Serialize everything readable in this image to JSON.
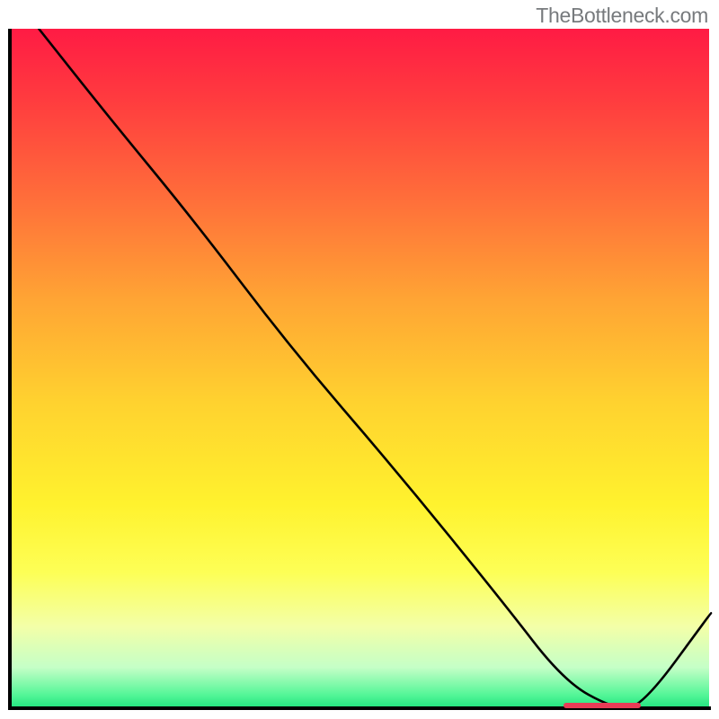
{
  "attribution": "TheBottleneck.com",
  "chart_data": {
    "type": "line",
    "title": "",
    "xlabel": "",
    "ylabel": "",
    "xlim": [
      0,
      100
    ],
    "ylim": [
      0,
      100
    ],
    "grid": false,
    "legend": false,
    "background_gradient": {
      "direction": "vertical",
      "stops": [
        {
          "pos": 0.0,
          "color": "#ff1b44"
        },
        {
          "pos": 0.25,
          "color": "#ff6e3a"
        },
        {
          "pos": 0.55,
          "color": "#ffd22f"
        },
        {
          "pos": 0.8,
          "color": "#fdff56"
        },
        {
          "pos": 0.94,
          "color": "#c5ffc7"
        },
        {
          "pos": 1.0,
          "color": "#1fe47e"
        }
      ]
    },
    "series": [
      {
        "name": "curve",
        "x": [
          4,
          14,
          26,
          40,
          55,
          70,
          79,
          86,
          90,
          100
        ],
        "y": [
          100,
          87,
          72,
          53,
          35,
          16,
          4,
          0,
          0,
          14
        ],
        "color": "#000000"
      }
    ],
    "marker": {
      "name": "highlight-segment",
      "x_start": 79,
      "x_end": 90,
      "y": 0,
      "color": "#e83c56"
    }
  }
}
